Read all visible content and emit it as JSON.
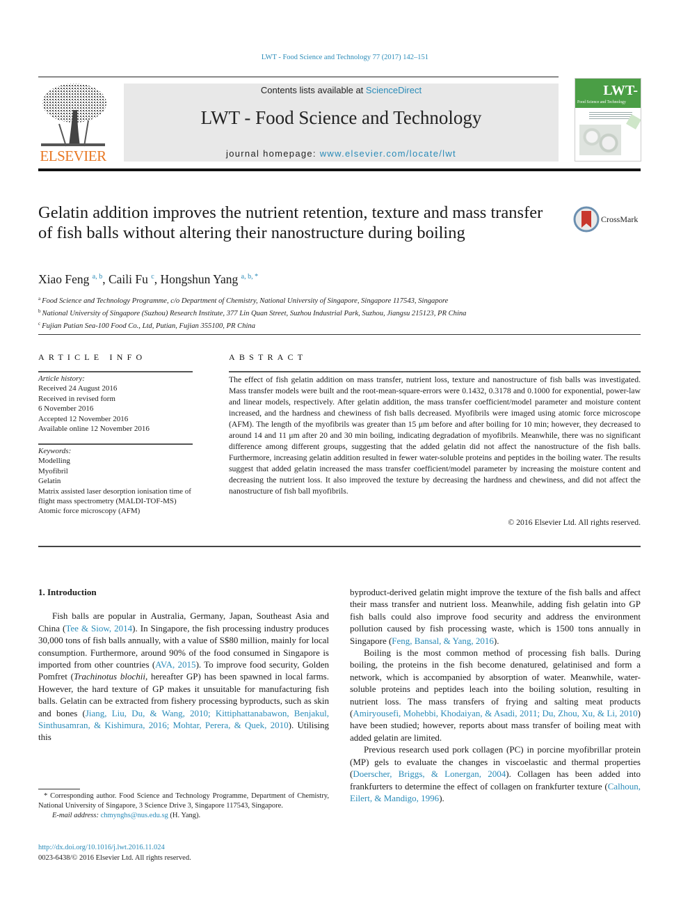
{
  "running_head": "LWT - Food Science and Technology 77 (2017) 142–151",
  "masthead": {
    "publisher": "ELSEVIER",
    "contents_prefix": "Contents lists available at ",
    "contents_link": "ScienceDirect",
    "journal_title": "LWT - Food Science and Technology",
    "homepage_prefix": "journal homepage: ",
    "homepage_link": "www.elsevier.com/locate/lwt",
    "cover_title": "LWT-",
    "cover_subtitle": "Food Science and Technology",
    "cover_color": "#4a9e45",
    "publisher_color": "#e87722",
    "link_color": "#2a8bb8"
  },
  "article": {
    "title": "Gelatin addition improves the nutrient retention, texture and mass transfer of fish balls without altering their nanostructure during boiling",
    "crossmark_label": "CrossMark",
    "authors": [
      {
        "name": "Xiao Feng",
        "sup": "a, b"
      },
      {
        "name": "Caili Fu",
        "sup": "c"
      },
      {
        "name": "Hongshun Yang",
        "sup": "a, b, *"
      }
    ],
    "affiliations": [
      {
        "key": "a",
        "text": "Food Science and Technology Programme, c/o Department of Chemistry, National University of Singapore, Singapore 117543, Singapore"
      },
      {
        "key": "b",
        "text": "National University of Singapore (Suzhou) Research Institute, 377 Lin Quan Street, Suzhou Industrial Park, Suzhou, Jiangsu 215123, PR China"
      },
      {
        "key": "c",
        "text": "Fujian Putian Sea-100 Food Co., Ltd, Putian, Fujian 355100, PR China"
      }
    ]
  },
  "article_info": {
    "heading": "ARTICLE INFO",
    "history_label": "Article history:",
    "history": [
      "Received 24 August 2016",
      "Received in revised form",
      "6 November 2016",
      "Accepted 12 November 2016",
      "Available online 12 November 2016"
    ],
    "keywords_label": "Keywords:",
    "keywords": [
      "Modelling",
      "Myofibril",
      "Gelatin",
      "Matrix assisted laser desorption ionisation time of flight mass spectrometry (MALDI-TOF-MS)",
      "Atomic force microscopy (AFM)"
    ]
  },
  "abstract": {
    "heading": "ABSTRACT",
    "text": "The effect of fish gelatin addition on mass transfer, nutrient loss, texture and nanostructure of fish balls was investigated. Mass transfer models were built and the root-mean-square-errors were 0.1432, 0.3178 and 0.1000 for exponential, power-law and linear models, respectively. After gelatin addition, the mass transfer coefficient/model parameter and moisture content increased, and the hardness and chewiness of fish balls decreased. Myofibrils were imaged using atomic force microscope (AFM). The length of the myofibrils was greater than 15 μm before and after boiling for 10 min; however, they decreased to around 14 and 11 μm after 20 and 30 min boiling, indicating degradation of myofibrils. Meanwhile, there was no significant difference among different groups, suggesting that the added gelatin did not affect the nanostructure of the fish balls. Furthermore, increasing gelatin addition resulted in fewer water-soluble proteins and peptides in the boiling water. The results suggest that added gelatin increased the mass transfer coefficient/model parameter by increasing the moisture content and decreasing the nutrient loss. It also improved the texture by decreasing the hardness and chewiness, and did not affect the nanostructure of fish ball myofibrils.",
    "copyright": "© 2016 Elsevier Ltd. All rights reserved."
  },
  "introduction": {
    "heading": "1.  Introduction",
    "left_paragraphs": [
      [
        {
          "t": "Fish balls are popular in Australia, Germany, Japan, Southeast Asia and China ("
        },
        {
          "t": "Tee & Siow, 2014",
          "link": true
        },
        {
          "t": "). In Singapore, the fish processing industry produces 30,000 tons of fish balls annually, with a value of S$80 million, mainly for local consumption. Furthermore, around 90% of the food consumed in Singapore is imported from other countries ("
        },
        {
          "t": "AVA, 2015",
          "link": true
        },
        {
          "t": "). To improve food security, Golden Pomfret ("
        },
        {
          "t": "Trachinotus blochii",
          "italic": true
        },
        {
          "t": ", hereafter GP) has been spawned in local farms. However, the hard texture of GP makes it unsuitable for manufacturing fish balls. Gelatin can be extracted from fishery processing byproducts, such as skin and bones ("
        },
        {
          "t": "Jiang, Liu, Du, & Wang, 2010; Kittiphattanabawon, Benjakul, Sinthusamran, & Kishimura, 2016; Mohtar, Perera, & Quek, 2010",
          "link": true
        },
        {
          "t": "). Utilising this"
        }
      ]
    ],
    "right_paragraphs": [
      [
        {
          "t": "byproduct-derived gelatin might improve the texture of the fish balls and affect their mass transfer and nutrient loss. Meanwhile, adding fish gelatin into GP fish balls could also improve food se­curity and address the environment pollution caused by fish pro­cessing waste, which is 1500 tons annually in Singapore ("
        },
        {
          "t": "Feng, Bansal, & Yang, 2016",
          "link": true
        },
        {
          "t": ")."
        }
      ],
      [
        {
          "t": "Boiling is the most common method of processing fish balls. During boiling, the proteins in the fish become denatured, gelati­nised and form a network, which is accompanied by absorption of water. Meanwhile, water-soluble proteins and peptides leach into the boiling solution, resulting in nutrient loss. The mass transfers of frying and salting meat products ("
        },
        {
          "t": "Amiryousefi, Mohebbi, Khodaiyan, & Asadi, 2011; Du, Zhou, Xu, & Li, 2010",
          "link": true
        },
        {
          "t": ") have been studied; however, reports about mass transfer of boiling meat with added gelatin are limited."
        }
      ],
      [
        {
          "t": "Previous research used pork collagen (PC) in porcine myofi­brillar protein (MP) gels to evaluate the changes in viscoelastic and thermal properties ("
        },
        {
          "t": "Doerscher, Briggs, & Lonergan, 2004",
          "link": true
        },
        {
          "t": "). Collagen has been added into frankfurters to determine the effect of collagen on frankfurter texture ("
        },
        {
          "t": "Calhoun, Eilert, & Mandigo, 1996",
          "link": true
        },
        {
          "t": ")."
        }
      ]
    ]
  },
  "footnote": {
    "corresponding": "* Corresponding author. Food Science and Technology Programme, Department of Chemistry, National University of Singapore, 3 Science Drive 3, Singapore 117543, Singapore.",
    "email_label": "E-mail address:",
    "email": "chmynghs@nus.edu.sg",
    "email_suffix": " (H. Yang).",
    "doi": "http://dx.doi.org/10.1016/j.lwt.2016.11.024",
    "issn_line": "0023-6438/© 2016 Elsevier Ltd. All rights reserved."
  }
}
